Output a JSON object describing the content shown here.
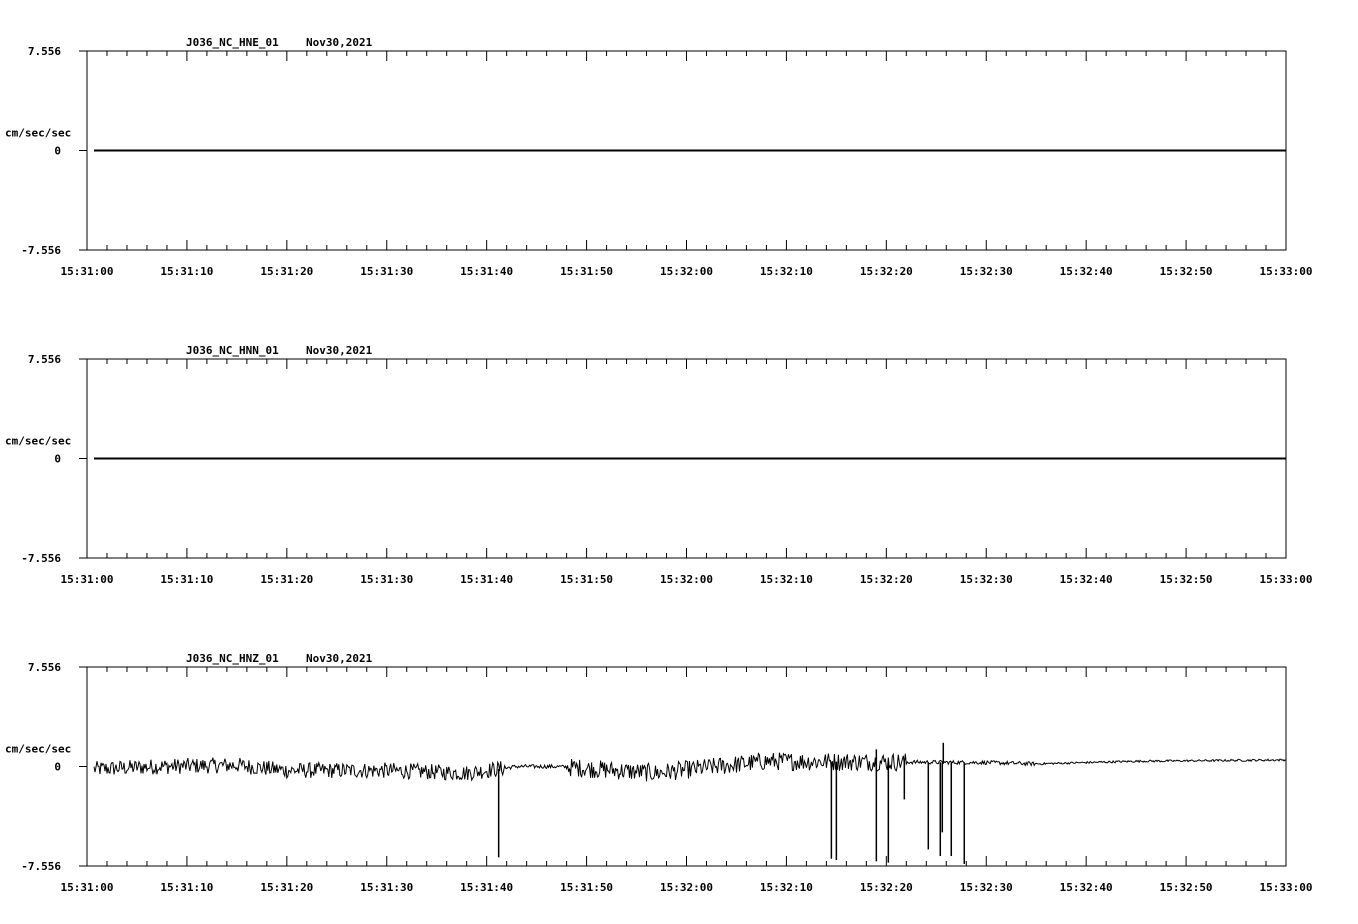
{
  "chart_data": [
    {
      "type": "line",
      "title": "J036_NC_HNE_01",
      "date": "Nov30,2021",
      "ylabel": "cm/sec/sec",
      "ylim": [
        -7.556,
        7.556
      ],
      "yticks": [
        "7.556",
        "0",
        "-7.556"
      ],
      "xlim": [
        "15:31:00",
        "15:33:00"
      ],
      "xticks": [
        "15:31:00",
        "15:31:10",
        "15:31:20",
        "15:31:30",
        "15:31:40",
        "15:31:50",
        "15:32:00",
        "15:32:10",
        "15:32:20",
        "15:32:30",
        "15:32:40",
        "15:32:50",
        "15:33:00"
      ],
      "trace": {
        "start": "15:31:00.7",
        "end": "15:33:00",
        "baseline": 0,
        "noise": 0,
        "spikes": []
      },
      "grid": false,
      "line_color": "#000000"
    },
    {
      "type": "line",
      "title": "J036_NC_HNN_01",
      "date": "Nov30,2021",
      "ylabel": "cm/sec/sec",
      "ylim": [
        -7.556,
        7.556
      ],
      "yticks": [
        "7.556",
        "0",
        "-7.556"
      ],
      "xlim": [
        "15:31:00",
        "15:33:00"
      ],
      "xticks": [
        "15:31:00",
        "15:31:10",
        "15:31:20",
        "15:31:30",
        "15:31:40",
        "15:31:50",
        "15:32:00",
        "15:32:10",
        "15:32:20",
        "15:32:30",
        "15:32:40",
        "15:32:50",
        "15:33:00"
      ],
      "trace": {
        "start": "15:31:00.7",
        "end": "15:33:00",
        "baseline": 0,
        "noise": 0,
        "spikes": []
      },
      "grid": false,
      "line_color": "#000000"
    },
    {
      "type": "line",
      "title": "J036_NC_HNZ_01",
      "date": "Nov30,2021",
      "ylabel": "cm/sec/sec",
      "ylim": [
        -7.556,
        7.556
      ],
      "yticks": [
        "7.556",
        "0",
        "-7.556"
      ],
      "xlim": [
        "15:31:00",
        "15:33:00"
      ],
      "xticks": [
        "15:31:00",
        "15:31:10",
        "15:31:20",
        "15:31:30",
        "15:31:40",
        "15:31:50",
        "15:32:00",
        "15:32:10",
        "15:32:20",
        "15:32:30",
        "15:32:40",
        "15:32:50",
        "15:33:00"
      ],
      "trace": {
        "start": "15:31:00.7",
        "end": "15:33:00",
        "baseline_segments": [
          [
            "15:31:00.7",
            -0.2
          ],
          [
            "15:31:07",
            0.0
          ],
          [
            "15:31:15",
            0.1
          ],
          [
            "15:31:20",
            -0.3
          ],
          [
            "15:31:30",
            -0.3
          ],
          [
            "15:31:38",
            -0.5
          ],
          [
            "15:31:43",
            0.0
          ],
          [
            "15:31:47",
            0.0
          ],
          [
            "15:31:57",
            -0.5
          ],
          [
            "15:32:03",
            0.0
          ],
          [
            "15:32:08",
            0.4
          ],
          [
            "15:32:30",
            0.3
          ],
          [
            "15:32:35",
            0.2
          ],
          [
            "15:32:45",
            0.4
          ],
          [
            "15:33:00",
            0.5
          ]
        ],
        "noise_segments": [
          [
            "15:31:00.7",
            "15:31:42",
            0.6
          ],
          [
            "15:31:42",
            "15:31:48",
            0.15
          ],
          [
            "15:31:48",
            "15:32:22",
            0.7
          ],
          [
            "15:32:22",
            "15:32:35",
            0.15
          ],
          [
            "15:32:35",
            "15:33:00",
            0.08
          ]
        ],
        "spikes": [
          {
            "t": "15:31:41.2",
            "v": -6.9
          },
          {
            "t": "15:32:25.4",
            "v": -6.8
          },
          {
            "t": "15:32:25.6",
            "v": -5.0
          },
          {
            "t": "15:32:26.5",
            "v": -6.8
          },
          {
            "t": "15:32:27.8",
            "v": -7.4
          },
          {
            "t": "15:32:14.5",
            "v": -7.0
          },
          {
            "t": "15:32:15.0",
            "v": -7.1
          },
          {
            "t": "15:32:19.0",
            "v": -7.2
          },
          {
            "t": "15:32:20.2",
            "v": -7.3
          },
          {
            "t": "15:32:21.8",
            "v": -2.5
          },
          {
            "t": "15:32:24.2",
            "v": -6.3
          },
          {
            "t": "15:32:25.7",
            "v": 1.8
          },
          {
            "t": "15:32:19.0",
            "v": 1.3
          }
        ]
      },
      "grid": false,
      "line_color": "#000000"
    }
  ]
}
